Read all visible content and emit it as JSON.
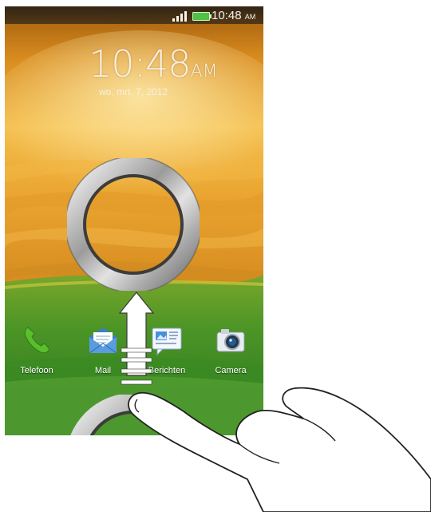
{
  "status_bar": {
    "time": "10:48",
    "ampm": "AM",
    "icons": [
      "signal-icon",
      "battery-icon"
    ]
  },
  "lock_screen": {
    "clock_time": "10:48",
    "clock_ampm": "AM",
    "date": "wo, mrt. 7, 2012",
    "unlock_ring": "lock-ring",
    "gesture": "swipe-up-arrow"
  },
  "dock": {
    "items": [
      {
        "label": "Telefoon",
        "icon": "phone-icon"
      },
      {
        "label": "Mail",
        "icon": "mail-icon"
      },
      {
        "label": "Berichten",
        "icon": "messages-icon"
      },
      {
        "label": "Camera",
        "icon": "camera-icon"
      }
    ]
  },
  "colors": {
    "sky_top": "#b86a10",
    "sky_mid": "#f1b33c",
    "hills": "#d9a028",
    "grass": "#3f8f23",
    "ring": "#9a9a9a",
    "battery": "#4ac94a"
  }
}
